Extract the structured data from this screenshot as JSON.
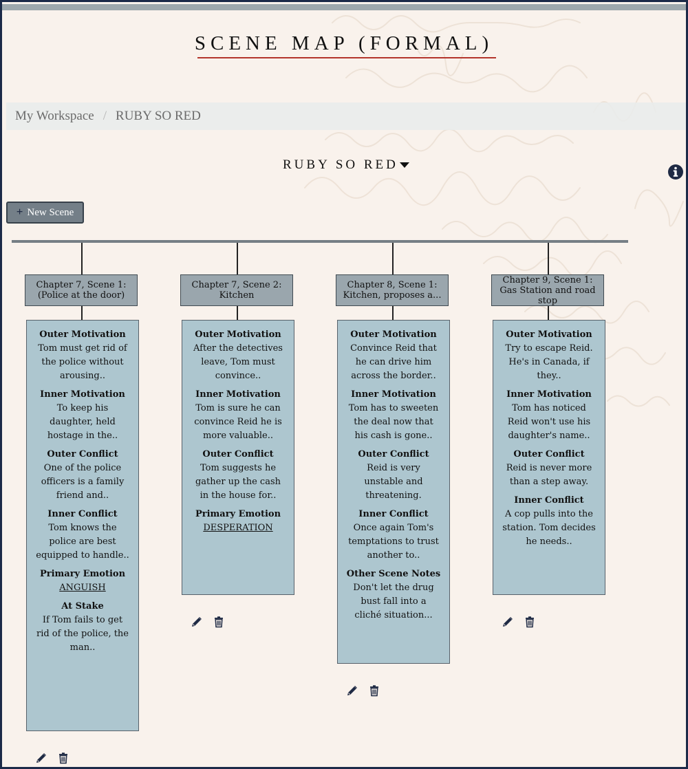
{
  "page": {
    "title": "SCENE MAP (FORMAL)"
  },
  "breadcrumb": {
    "items": [
      "My Workspace",
      "RUBY SO RED"
    ],
    "separator": "/"
  },
  "project_select": {
    "label": "RUBY SO RED",
    "icon": "caret-down-icon"
  },
  "toolbar": {
    "new_scene_label": "New Scene",
    "new_scene_icon": "plus-icon",
    "info_icon": "info-circle-icon"
  },
  "colors": {
    "accent_rule": "#b3342a",
    "card_bg": "#adc6cf",
    "header_bg": "#9aa6ad",
    "button_bg": "#747f88",
    "icon": "#1f2a44"
  },
  "scenes": [
    {
      "heading": "Chapter 7, Scene 1: (Police at the door)",
      "fields": [
        {
          "title": "Outer Motivation",
          "text": "Tom must get rid of the police without arousing.."
        },
        {
          "title": "Inner Motivation",
          "text": "To keep his daughter, held hostage in the.."
        },
        {
          "title": "Outer Conflict",
          "text": "One of the police officers is a family friend and.."
        },
        {
          "title": "Inner Conflict",
          "text": "Tom knows the police are best equipped to handle.."
        },
        {
          "title": "Primary Emotion",
          "text": "ANGUISH"
        },
        {
          "title": "At Stake",
          "text": "If Tom fails to get rid of the police, the man.."
        }
      ]
    },
    {
      "heading": "Chapter 7, Scene 2: Kitchen",
      "fields": [
        {
          "title": "Outer Motivation",
          "text": "After the detectives leave, Tom must convince.."
        },
        {
          "title": "Inner Motivation",
          "text": "Tom is sure he can convince Reid he is more valuable.."
        },
        {
          "title": "Outer Conflict",
          "text": "Tom suggests he gather up the cash in the house for.."
        },
        {
          "title": "Primary Emotion",
          "text": "DESPERATION"
        }
      ]
    },
    {
      "heading": "Chapter 8, Scene 1: Kitchen, proposes a...",
      "fields": [
        {
          "title": "Outer Motivation",
          "text": "Convince Reid that he can drive him across the border.."
        },
        {
          "title": "Inner Motivation",
          "text": "Tom has to sweeten the deal now that his cash is gone.."
        },
        {
          "title": "Outer Conflict",
          "text": "Reid is very unstable and threatening."
        },
        {
          "title": "Inner Conflict",
          "text": "Once again Tom's temptations to trust another to.."
        },
        {
          "title": "Other Scene Notes",
          "text": "Don't let the drug bust fall into a cliché situation..."
        }
      ]
    },
    {
      "heading": "Chapter 9, Scene 1: Gas Station and road stop",
      "fields": [
        {
          "title": "Outer Motivation",
          "text": "Try to escape Reid. He's in Canada, if they.."
        },
        {
          "title": "Inner Motivation",
          "text": "Tom has noticed Reid won't use his daughter's name.."
        },
        {
          "title": "Outer Conflict",
          "text": "Reid is never more than a step away."
        },
        {
          "title": "Inner Conflict",
          "text": "A cop pulls into the station. Tom decides he needs.."
        }
      ]
    }
  ],
  "scene_actions": {
    "edit_icon": "pencil-icon",
    "delete_icon": "trash-icon"
  }
}
